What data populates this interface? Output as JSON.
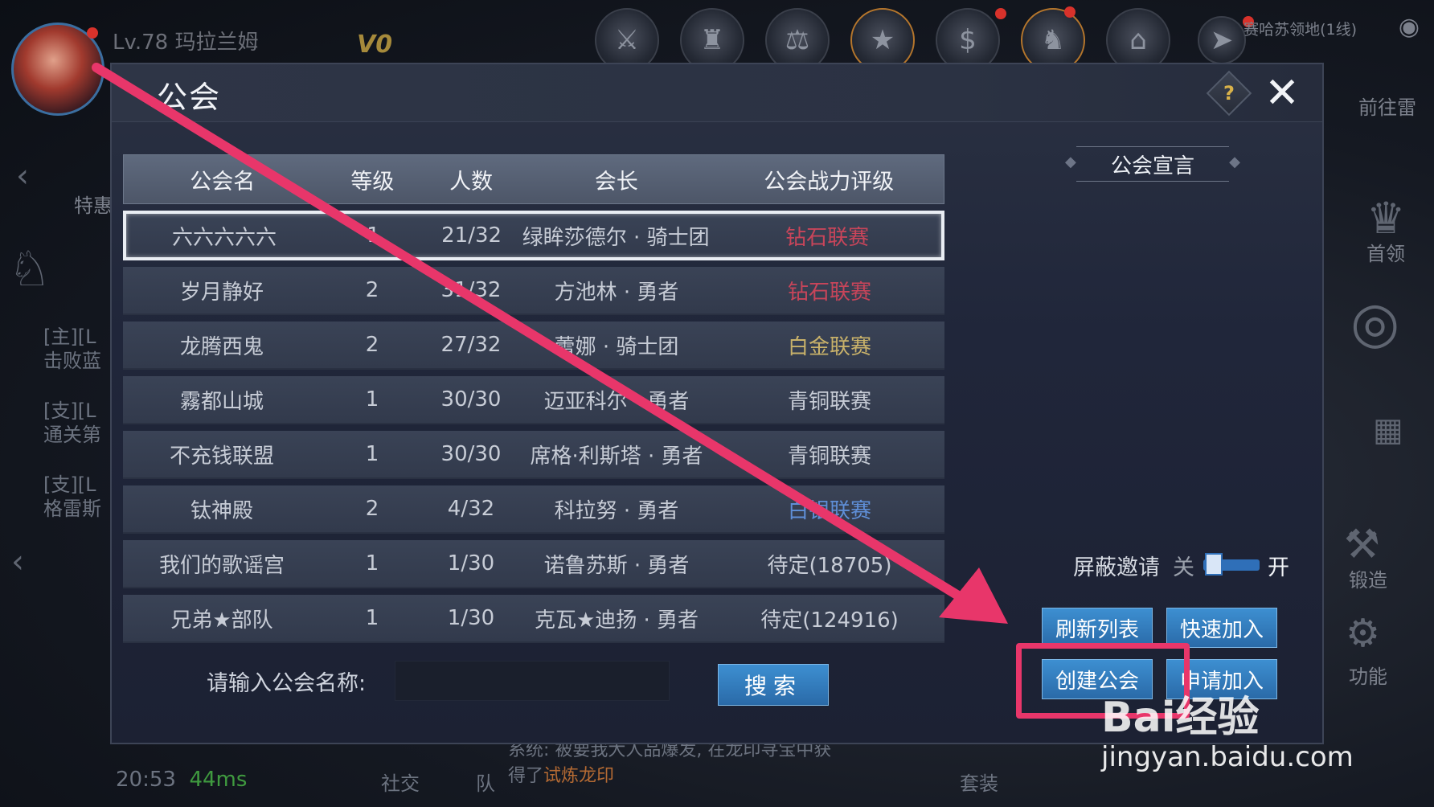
{
  "player": {
    "level_name": "Lv.78 玛拉兰姆",
    "vip": "V0",
    "map": "赛哈苏领地(1线)"
  },
  "side": {
    "left_label": "特惠",
    "right_labels": [
      "前往雷",
      "首领",
      "锻造",
      "功能"
    ]
  },
  "chat": [
    {
      "prefix": "[主][L",
      "text": "击败蓝"
    },
    {
      "prefix": "[支][L",
      "text": "通关第"
    },
    {
      "prefix": "[支][L",
      "text": "格雷斯"
    }
  ],
  "bottom": {
    "time": "20:53",
    "ping": "44ms",
    "social": "社交",
    "team": "队",
    "outfit": "套装",
    "system_msg_line1": "系统: 被要我大人品爆发, 在龙印寻宝中获",
    "system_msg_line2_pre": "得了",
    "system_msg_line2_hl": "试炼龙印"
  },
  "dialog": {
    "title": "公会",
    "help": "?",
    "close": "✕"
  },
  "table": {
    "headers": [
      "公会名",
      "等级",
      "人数",
      "会长",
      "公会战力评级"
    ],
    "rows": [
      {
        "name": "六六六六六",
        "level": "1",
        "members": "21/32",
        "leader": "绿眸莎德尔 · 骑士团",
        "rating": "钻石联赛",
        "rating_color": "#c8455a"
      },
      {
        "name": "岁月静好",
        "level": "2",
        "members": "31/32",
        "leader": "方池林 · 勇者",
        "rating": "钻石联赛",
        "rating_color": "#c8455a"
      },
      {
        "name": "龙腾西鬼",
        "level": "2",
        "members": "27/32",
        "leader": "蕾娜 · 骑士团",
        "rating": "白金联赛",
        "rating_color": "#c9b26a"
      },
      {
        "name": "霧都山城",
        "level": "1",
        "members": "30/30",
        "leader": "迈亚科尔 · 勇者",
        "rating": "青铜联赛",
        "rating_color": "#c7ccd6"
      },
      {
        "name": "不充钱联盟",
        "level": "1",
        "members": "30/30",
        "leader": "席格·利斯塔 · 勇者",
        "rating": "青铜联赛",
        "rating_color": "#c7ccd6"
      },
      {
        "name": "钛神殿",
        "level": "2",
        "members": "4/32",
        "leader": "科拉努 · 勇者",
        "rating": "白银联赛",
        "rating_color": "#5f8fd8"
      },
      {
        "name": "我们的歌谣宫",
        "level": "1",
        "members": "1/30",
        "leader": "诺鲁苏斯 · 勇者",
        "rating": "待定(18705)",
        "rating_color": "#c7ccd6"
      },
      {
        "name": "兄弟★部队",
        "level": "1",
        "members": "1/30",
        "leader": "克瓦★迪扬 · 勇者",
        "rating": "待定(124916)",
        "rating_color": "#c7ccd6"
      }
    ]
  },
  "search": {
    "label": "请输入公会名称:",
    "placeholder": "",
    "value": "",
    "button": "搜索"
  },
  "right_panel": {
    "declaration": "公会宣言",
    "block_invite": "屏蔽邀请",
    "toggle_off": "关",
    "toggle_on": "开",
    "toggle_state": "off",
    "refresh": "刷新列表",
    "quick_join": "快速加入",
    "create": "创建公会",
    "apply_join": "申请加入"
  },
  "annotation": {
    "arrow_color": "#e8366a",
    "watermark": "Bai经验",
    "watermark_url": "jingyan.baidu.com"
  }
}
